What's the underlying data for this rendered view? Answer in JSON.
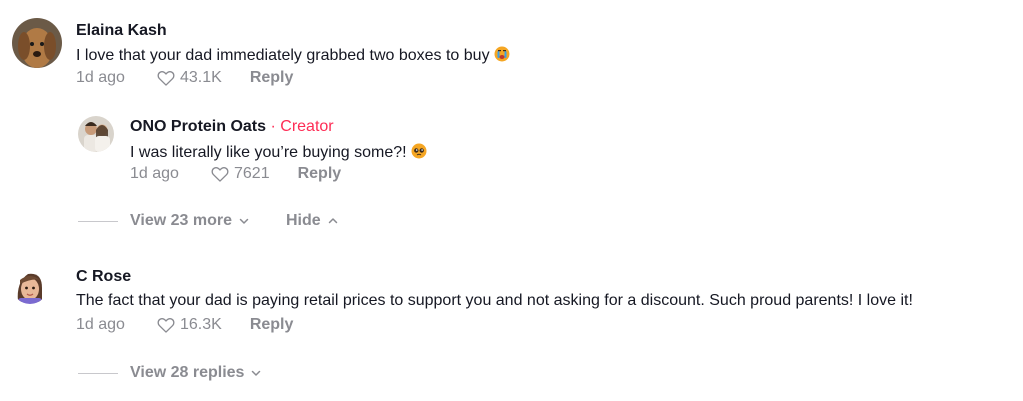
{
  "comments": [
    {
      "author": "Elaina Kash",
      "text": "I love that your dad immediately grabbed two boxes to buy",
      "emoji": "crying-emoji",
      "age": "1d ago",
      "likes": "43.1K",
      "reply_label": "Reply",
      "replies": [
        {
          "author": "ONO Protein Oats",
          "separator": "·",
          "badge": "Creator",
          "text": "I was literally like you’re buying some?!",
          "emoji": "pleading-emoji",
          "age": "1d ago",
          "likes": "7621",
          "reply_label": "Reply"
        }
      ],
      "view_more_label": "View 23 more",
      "hide_label": "Hide"
    },
    {
      "author": "C Rose",
      "text": "The fact that your dad is paying retail prices to support you and not asking for a discount. Such proud parents! I love it!",
      "age": "1d ago",
      "likes": "16.3K",
      "reply_label": "Reply",
      "view_replies_label": "View 28 replies"
    }
  ],
  "colors": {
    "text": "#161823",
    "muted": "#8a8b91",
    "creator": "#fe2c55"
  }
}
